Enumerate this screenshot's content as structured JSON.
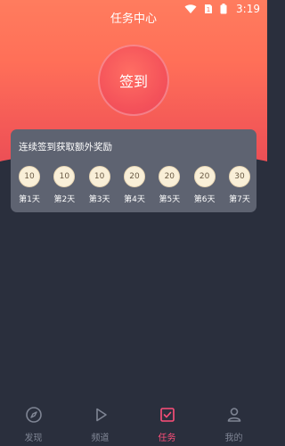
{
  "status_bar": {
    "time": "3:19"
  },
  "header": {
    "title": "任务中心"
  },
  "signin": {
    "label": "签到"
  },
  "reward_card": {
    "title": "连续签到获取额外奖励",
    "days": [
      {
        "coins": "10",
        "label": "第1天"
      },
      {
        "coins": "10",
        "label": "第2天"
      },
      {
        "coins": "10",
        "label": "第3天"
      },
      {
        "coins": "20",
        "label": "第4天"
      },
      {
        "coins": "20",
        "label": "第5天"
      },
      {
        "coins": "20",
        "label": "第6天"
      },
      {
        "coins": "30",
        "label": "第7天"
      }
    ]
  },
  "tabbar": {
    "items": [
      {
        "label": "发现",
        "icon": "compass-icon"
      },
      {
        "label": "频道",
        "icon": "play-icon"
      },
      {
        "label": "任务",
        "icon": "task-check-icon"
      },
      {
        "label": "我的",
        "icon": "user-icon"
      }
    ],
    "active_index": 2,
    "active_color": "#ff4f7a"
  },
  "colors": {
    "header_top": "#ff7c5e",
    "header_bottom": "#e84a55",
    "background": "#2a2f3d",
    "card": "#5e6371"
  }
}
